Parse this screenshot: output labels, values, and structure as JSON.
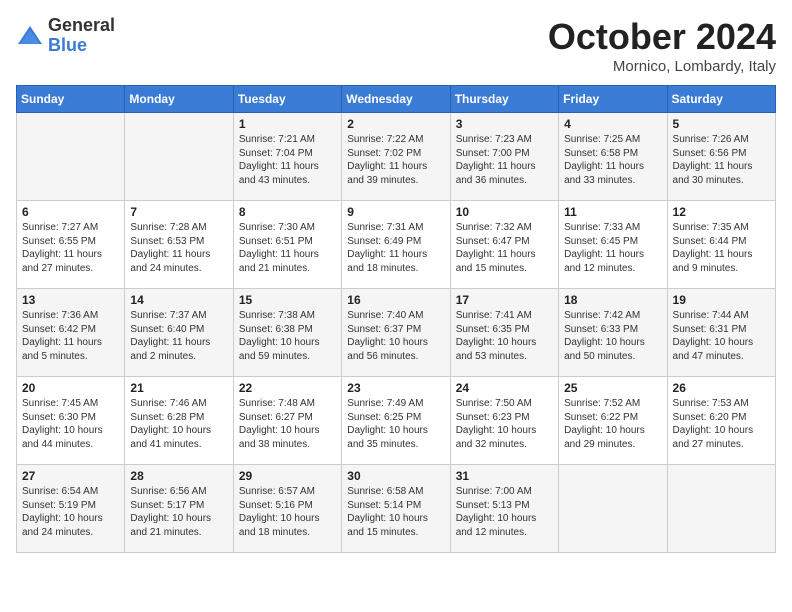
{
  "header": {
    "logo_general": "General",
    "logo_blue": "Blue",
    "month": "October 2024",
    "location": "Mornico, Lombardy, Italy"
  },
  "days_of_week": [
    "Sunday",
    "Monday",
    "Tuesday",
    "Wednesday",
    "Thursday",
    "Friday",
    "Saturday"
  ],
  "weeks": [
    [
      {
        "day": "",
        "content": ""
      },
      {
        "day": "",
        "content": ""
      },
      {
        "day": "1",
        "content": "Sunrise: 7:21 AM\nSunset: 7:04 PM\nDaylight: 11 hours and 43 minutes."
      },
      {
        "day": "2",
        "content": "Sunrise: 7:22 AM\nSunset: 7:02 PM\nDaylight: 11 hours and 39 minutes."
      },
      {
        "day": "3",
        "content": "Sunrise: 7:23 AM\nSunset: 7:00 PM\nDaylight: 11 hours and 36 minutes."
      },
      {
        "day": "4",
        "content": "Sunrise: 7:25 AM\nSunset: 6:58 PM\nDaylight: 11 hours and 33 minutes."
      },
      {
        "day": "5",
        "content": "Sunrise: 7:26 AM\nSunset: 6:56 PM\nDaylight: 11 hours and 30 minutes."
      }
    ],
    [
      {
        "day": "6",
        "content": "Sunrise: 7:27 AM\nSunset: 6:55 PM\nDaylight: 11 hours and 27 minutes."
      },
      {
        "day": "7",
        "content": "Sunrise: 7:28 AM\nSunset: 6:53 PM\nDaylight: 11 hours and 24 minutes."
      },
      {
        "day": "8",
        "content": "Sunrise: 7:30 AM\nSunset: 6:51 PM\nDaylight: 11 hours and 21 minutes."
      },
      {
        "day": "9",
        "content": "Sunrise: 7:31 AM\nSunset: 6:49 PM\nDaylight: 11 hours and 18 minutes."
      },
      {
        "day": "10",
        "content": "Sunrise: 7:32 AM\nSunset: 6:47 PM\nDaylight: 11 hours and 15 minutes."
      },
      {
        "day": "11",
        "content": "Sunrise: 7:33 AM\nSunset: 6:45 PM\nDaylight: 11 hours and 12 minutes."
      },
      {
        "day": "12",
        "content": "Sunrise: 7:35 AM\nSunset: 6:44 PM\nDaylight: 11 hours and 9 minutes."
      }
    ],
    [
      {
        "day": "13",
        "content": "Sunrise: 7:36 AM\nSunset: 6:42 PM\nDaylight: 11 hours and 5 minutes."
      },
      {
        "day": "14",
        "content": "Sunrise: 7:37 AM\nSunset: 6:40 PM\nDaylight: 11 hours and 2 minutes."
      },
      {
        "day": "15",
        "content": "Sunrise: 7:38 AM\nSunset: 6:38 PM\nDaylight: 10 hours and 59 minutes."
      },
      {
        "day": "16",
        "content": "Sunrise: 7:40 AM\nSunset: 6:37 PM\nDaylight: 10 hours and 56 minutes."
      },
      {
        "day": "17",
        "content": "Sunrise: 7:41 AM\nSunset: 6:35 PM\nDaylight: 10 hours and 53 minutes."
      },
      {
        "day": "18",
        "content": "Sunrise: 7:42 AM\nSunset: 6:33 PM\nDaylight: 10 hours and 50 minutes."
      },
      {
        "day": "19",
        "content": "Sunrise: 7:44 AM\nSunset: 6:31 PM\nDaylight: 10 hours and 47 minutes."
      }
    ],
    [
      {
        "day": "20",
        "content": "Sunrise: 7:45 AM\nSunset: 6:30 PM\nDaylight: 10 hours and 44 minutes."
      },
      {
        "day": "21",
        "content": "Sunrise: 7:46 AM\nSunset: 6:28 PM\nDaylight: 10 hours and 41 minutes."
      },
      {
        "day": "22",
        "content": "Sunrise: 7:48 AM\nSunset: 6:27 PM\nDaylight: 10 hours and 38 minutes."
      },
      {
        "day": "23",
        "content": "Sunrise: 7:49 AM\nSunset: 6:25 PM\nDaylight: 10 hours and 35 minutes."
      },
      {
        "day": "24",
        "content": "Sunrise: 7:50 AM\nSunset: 6:23 PM\nDaylight: 10 hours and 32 minutes."
      },
      {
        "day": "25",
        "content": "Sunrise: 7:52 AM\nSunset: 6:22 PM\nDaylight: 10 hours and 29 minutes."
      },
      {
        "day": "26",
        "content": "Sunrise: 7:53 AM\nSunset: 6:20 PM\nDaylight: 10 hours and 27 minutes."
      }
    ],
    [
      {
        "day": "27",
        "content": "Sunrise: 6:54 AM\nSunset: 5:19 PM\nDaylight: 10 hours and 24 minutes."
      },
      {
        "day": "28",
        "content": "Sunrise: 6:56 AM\nSunset: 5:17 PM\nDaylight: 10 hours and 21 minutes."
      },
      {
        "day": "29",
        "content": "Sunrise: 6:57 AM\nSunset: 5:16 PM\nDaylight: 10 hours and 18 minutes."
      },
      {
        "day": "30",
        "content": "Sunrise: 6:58 AM\nSunset: 5:14 PM\nDaylight: 10 hours and 15 minutes."
      },
      {
        "day": "31",
        "content": "Sunrise: 7:00 AM\nSunset: 5:13 PM\nDaylight: 10 hours and 12 minutes."
      },
      {
        "day": "",
        "content": ""
      },
      {
        "day": "",
        "content": ""
      }
    ]
  ]
}
